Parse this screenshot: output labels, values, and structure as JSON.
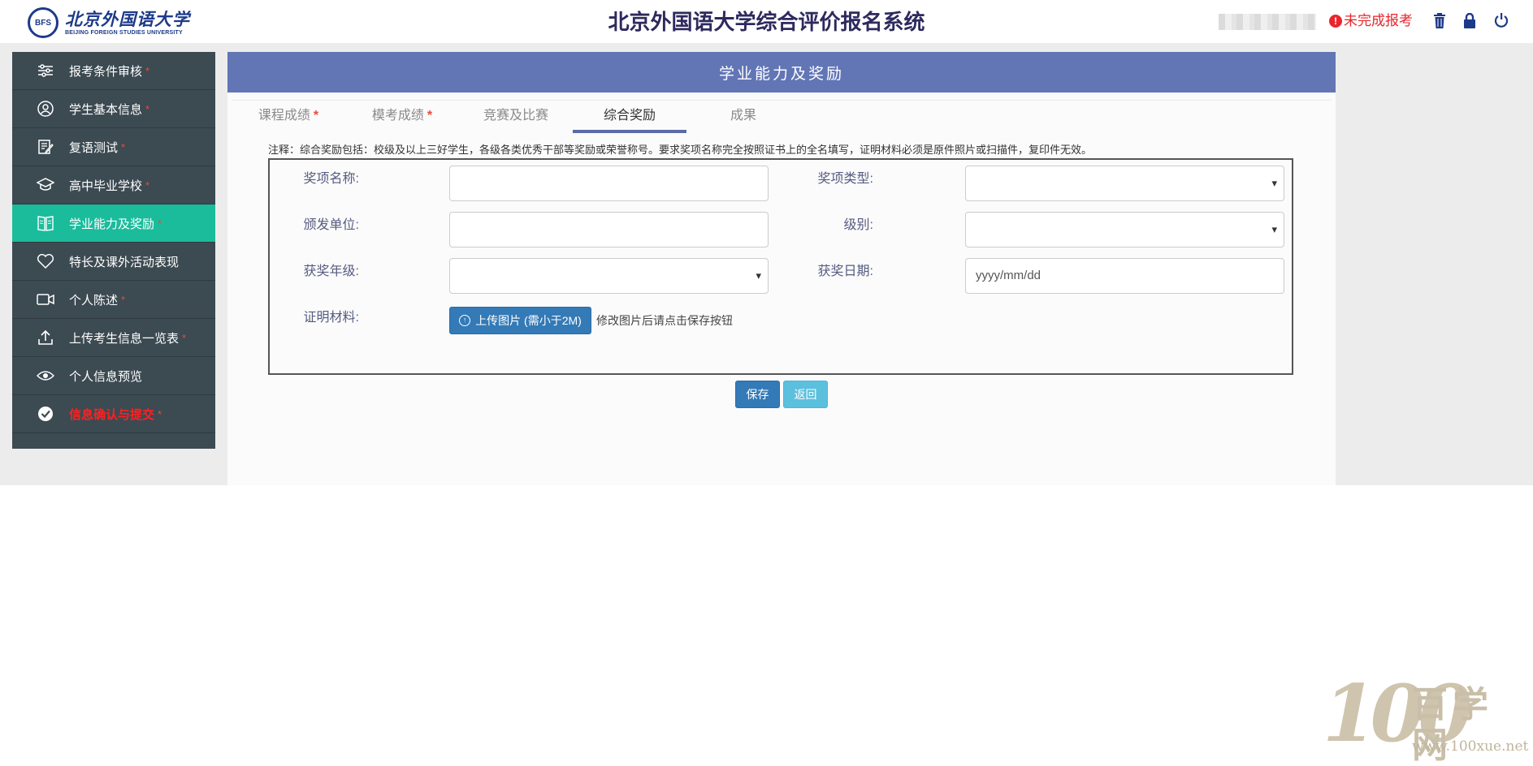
{
  "header": {
    "logo_seal_text": "BFS",
    "logo_cn": "北京外国语大学",
    "logo_en": "BEIJING FOREIGN STUDIES UNIVERSITY",
    "title": "北京外国语大学综合评价报名系统",
    "status_text": "未完成报考",
    "status_icon": "!",
    "icons": [
      "trash-icon",
      "lock-icon",
      "power-icon"
    ]
  },
  "sidebar": {
    "items": [
      {
        "label": "报考条件审核",
        "icon": "sliders-icon",
        "required": "*"
      },
      {
        "label": "学生基本信息",
        "icon": "user-circle-icon",
        "required": "*"
      },
      {
        "label": "复语测试",
        "icon": "edit-document-icon",
        "required": "*"
      },
      {
        "label": "高中毕业学校",
        "icon": "graduation-cap-icon",
        "required": "*"
      },
      {
        "label": "学业能力及奖励",
        "icon": "open-book-icon",
        "required": "*"
      },
      {
        "label": "特长及课外活动表现",
        "icon": "heart-icon",
        "required": ""
      },
      {
        "label": "个人陈述",
        "icon": "video-camera-icon",
        "required": "*"
      },
      {
        "label": "上传考生信息一览表",
        "icon": "upload-icon",
        "required": "*"
      },
      {
        "label": "个人信息预览",
        "icon": "eye-icon",
        "required": ""
      },
      {
        "label": "信息确认与提交",
        "icon": "check-circle-icon",
        "required": "*"
      }
    ],
    "active_index": 4,
    "active_color": "#1abc9c"
  },
  "main": {
    "heading": "学业能力及奖励",
    "tabs": [
      {
        "label": "课程成绩",
        "required": "*"
      },
      {
        "label": "模考成绩",
        "required": "*"
      },
      {
        "label": "竞赛及比赛",
        "required": ""
      },
      {
        "label": "综合奖励",
        "required": ""
      },
      {
        "label": "成果",
        "required": ""
      }
    ],
    "active_tab": 3,
    "note": "注释：综合奖励包括：校级及以上三好学生，各级各类优秀干部等奖励或荣誉称号。要求奖项名称完全按照证书上的全名填写，证明材料必须是原件照片或扫描件，复印件无效。",
    "form": {
      "award_name_label": "奖项名称:",
      "award_name_value": "",
      "award_type_label": "奖项类型:",
      "award_type_value": "",
      "issuer_label": "颁发单位:",
      "issuer_value": "",
      "level_label": "级别:",
      "level_value": "",
      "grade_label": "获奖年级:",
      "grade_value": "",
      "date_label": "获奖日期:",
      "date_value": "yyyy/mm/dd",
      "proof_label": "证明材料:",
      "upload_button": "上传图片 (需小于2M)",
      "upload_hint": "修改图片后请点击保存按钮"
    },
    "buttons": {
      "save": "保存",
      "back": "返回"
    }
  },
  "watermark": {
    "num": "100",
    "cn": "百学网",
    "url": "www.100xue.net"
  }
}
